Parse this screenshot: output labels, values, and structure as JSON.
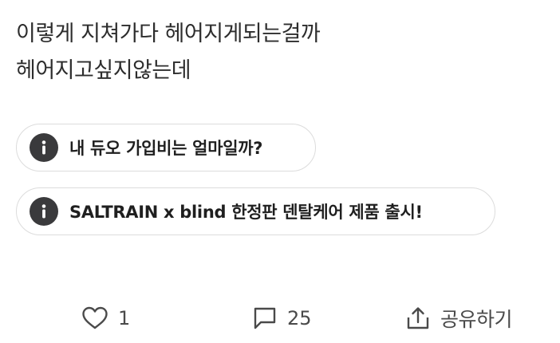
{
  "post": {
    "lines": [
      "이렇게 지쳐가다 헤어지게되는걸까",
      "헤어지고싶지않는데"
    ]
  },
  "related_links": [
    {
      "icon": "info-icon",
      "label": "내 듀오 가입비는 얼마일까?"
    },
    {
      "icon": "info-icon",
      "label": "SALTRAIN x blind 한정판 덴탈케어 제품 출시!"
    }
  ],
  "actions": {
    "like": {
      "icon": "heart-icon",
      "count": "1"
    },
    "comment": {
      "icon": "comment-icon",
      "count": "25"
    },
    "share": {
      "icon": "share-icon",
      "label": "공유하기"
    }
  }
}
